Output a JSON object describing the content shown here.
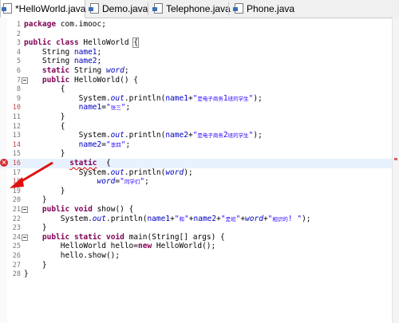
{
  "tabs": [
    {
      "label": "*HelloWorld.java",
      "close": "✕",
      "active": true
    },
    {
      "label": "Demo.java",
      "active": false
    },
    {
      "label": "Telephone.java",
      "active": false
    },
    {
      "label": "Phone.java",
      "active": false
    }
  ],
  "lines": [
    {
      "n": "1",
      "code": "package com.imooc;"
    },
    {
      "n": "2",
      "code": ""
    },
    {
      "n": "3",
      "code": "public class HelloWorld {"
    },
    {
      "n": "4",
      "code": "    String name1;"
    },
    {
      "n": "5",
      "code": "    String name2;"
    },
    {
      "n": "6",
      "code": "    static String word;"
    },
    {
      "n": "7",
      "code": "    public HelloWorld() {"
    },
    {
      "n": "8",
      "code": "        {"
    },
    {
      "n": "9",
      "code": "            System.out.println(name1+\"是电子商务1班的学生\");"
    },
    {
      "n": "10",
      "code": "            name1=\"张三\";"
    },
    {
      "n": "11",
      "code": "        }"
    },
    {
      "n": "12",
      "code": "        {"
    },
    {
      "n": "13",
      "code": "            System.out.println(name2+\"是电子商务2班的学生\");"
    },
    {
      "n": "14",
      "code": "            name2=\"李四\";"
    },
    {
      "n": "15",
      "code": "        }"
    },
    {
      "n": "16",
      "code": "          static  {"
    },
    {
      "n": "17",
      "code": "            System.out.println(word);"
    },
    {
      "n": "18",
      "code": "                word=\"同学们\";"
    },
    {
      "n": "19",
      "code": "        }"
    },
    {
      "n": "20",
      "code": "    }"
    },
    {
      "n": "21",
      "code": "    public void show() {"
    },
    {
      "n": "22",
      "code": "        System.out.println(name1+\"和\"+name2+\"是班\"+word+\"相识的! \");"
    },
    {
      "n": "23",
      "code": "    }"
    },
    {
      "n": "24",
      "code": "    public static void main(String[] args) {"
    },
    {
      "n": "25",
      "code": "        HelloWorld hello=new HelloWorld();"
    },
    {
      "n": "26",
      "code": "        hello.show();"
    },
    {
      "n": "27",
      "code": "    }"
    },
    {
      "n": "28",
      "code": "}"
    }
  ],
  "error_icon_glyph": "×",
  "colors": {
    "keyword": "#7f0055",
    "field": "#0000c0",
    "string": "#2a00ff",
    "error": "#e00000",
    "active_line": "#e8f2fe"
  }
}
